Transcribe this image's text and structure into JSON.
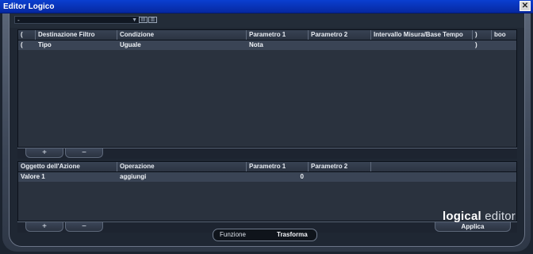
{
  "window": {
    "title": "Editor Logico",
    "close_icon": "close-icon"
  },
  "toolbar": {
    "preset_value": "-",
    "preset_arrow": "▼",
    "icon1": "store-preset-icon",
    "icon2": "remove-preset-icon"
  },
  "filter": {
    "columns": [
      "(",
      "Destinazione Filtro",
      "Condizione",
      "Parametro 1",
      "Parametro 2",
      "Intervallo Misura/Base Tempo",
      ")",
      "boo"
    ],
    "rows": [
      {
        "open": "(",
        "target": "Tipo",
        "condition": "Uguale",
        "param1": "Nota",
        "param2": "",
        "range": "",
        "close": ")",
        "bool": ""
      }
    ],
    "add_label": "+",
    "remove_label": "−"
  },
  "action": {
    "columns": [
      "Oggetto dell'Azione",
      "Operazione",
      "Parametro 1",
      "Parametro 2"
    ],
    "rows": [
      {
        "target": "Valore 1",
        "operation": "aggiungi",
        "param1": "0",
        "param2": ""
      }
    ],
    "add_label": "+",
    "remove_label": "−",
    "apply_label": "Applica"
  },
  "brand": {
    "part1": "logical",
    "part2": "editor"
  },
  "function": {
    "label": "Funzione",
    "value": "Trasforma"
  }
}
